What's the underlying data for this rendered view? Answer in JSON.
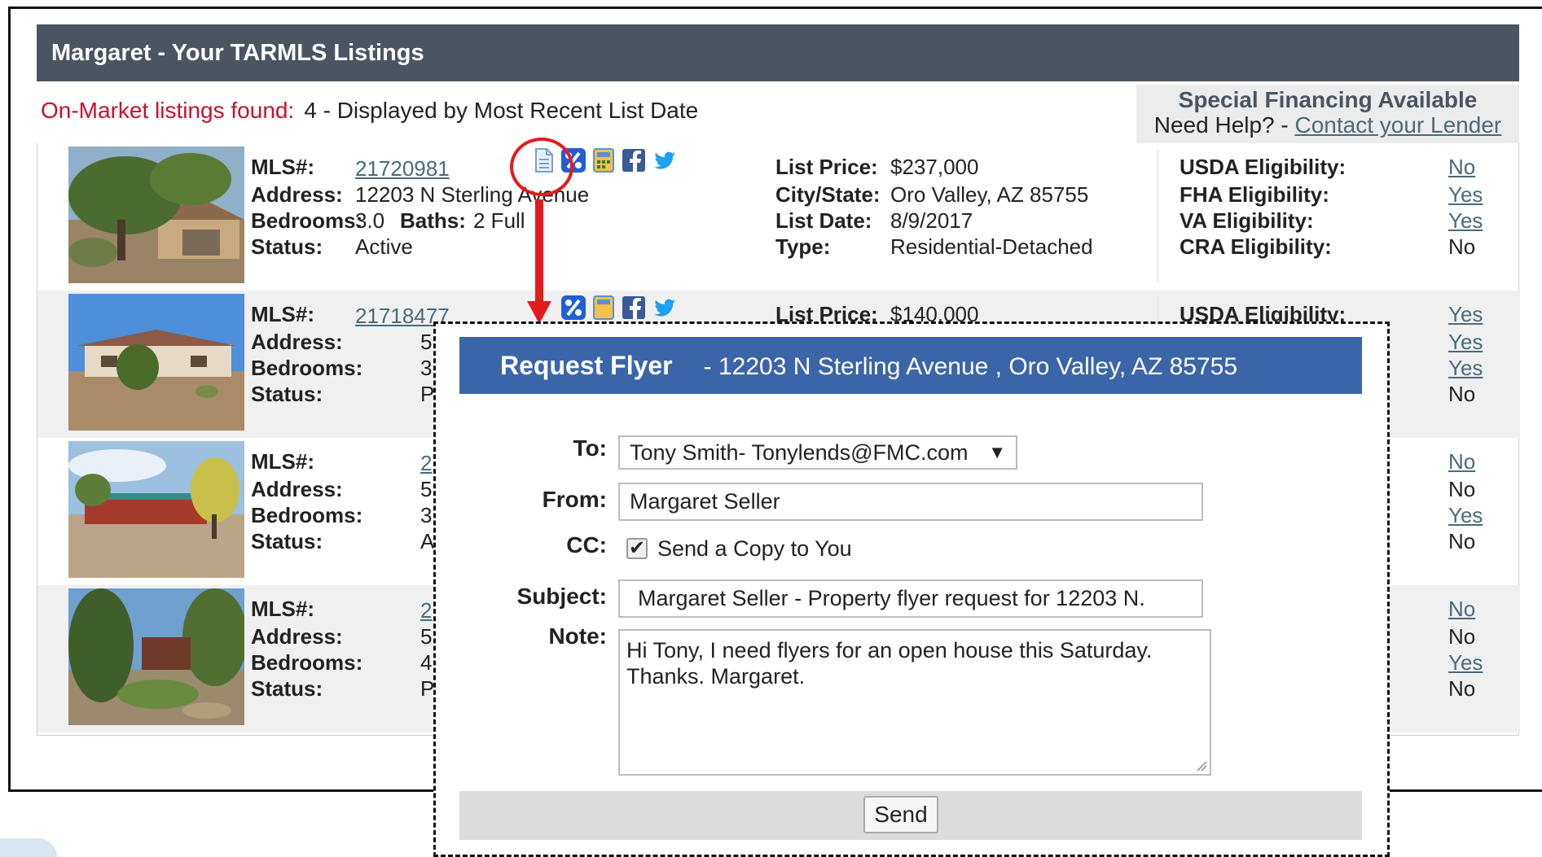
{
  "header": {
    "title": "Margaret  -  Your TARMLS Listings"
  },
  "summary": {
    "label": "On-Market listings found:",
    "value": "4 - Displayed by Most Recent List Date"
  },
  "financing": {
    "title": "Special Financing Available",
    "help_prefix": "Need Help? - ",
    "help_link": "Contact your Lender"
  },
  "labels": {
    "mls": "MLS#:",
    "address": "Address:",
    "bedrooms": "Bedrooms:",
    "baths": "Baths:",
    "status": "Status:",
    "list_price": "List Price:",
    "city_state": "City/State:",
    "list_date": "List Date:",
    "type": "Type:",
    "usda": "USDA Eligibility:",
    "fha": "FHA Eligibility:",
    "va": "VA Eligibility:",
    "cra": "CRA Eligibility:"
  },
  "listings": [
    {
      "mls": "21720981",
      "address": "12203 N Sterling Avenue",
      "bedrooms": "3.0",
      "baths": "2 Full",
      "status": "Active",
      "list_price": "$237,000",
      "city_state": "Oro Valley, AZ 85755",
      "list_date": "8/9/2017",
      "type": "Residential-Detached",
      "usda": "No",
      "fha": "Yes",
      "va": "Yes",
      "cra": "No"
    },
    {
      "mls": "21718477",
      "address": "5",
      "bedrooms": "3",
      "status": "P",
      "list_price": "$140,000",
      "usda": "Yes",
      "fha": "Yes",
      "va": "Yes",
      "cra": "No"
    },
    {
      "mls": "2",
      "address": "5",
      "bedrooms": "3",
      "status": "A",
      "usda": "No",
      "fha": "No",
      "va": "Yes",
      "cra": "No"
    },
    {
      "mls": "2",
      "address": "5",
      "bedrooms": "4",
      "status": "P",
      "usda": "No",
      "fha": "No",
      "va": "Yes",
      "cra": "No"
    }
  ],
  "icons": [
    "flyer-icon",
    "percent-icon",
    "calculator-icon",
    "facebook-icon",
    "twitter-icon"
  ],
  "modal": {
    "title": "Request Flyer",
    "subtitle": "- 12203 N Sterling Avenue , Oro Valley, AZ 85755",
    "to_label": "To:",
    "to_value": "Tony Smith- Tonylends@FMC.com",
    "from_label": "From:",
    "from_value": "Margaret Seller",
    "cc_label": "CC:",
    "cc_text": "Send a Copy to You",
    "cc_checked": true,
    "subject_label": "Subject:",
    "subject_value": "Margaret Seller - Property flyer request for 12203 N.",
    "note_label": "Note:",
    "note_value": "Hi Tony, I need flyers for an open house this Saturday. Thanks. Margaret.",
    "send_label": "Send"
  },
  "colors": {
    "header_bg": "#4a5561",
    "modal_header_bg": "#3a66a8",
    "alert_red": "#c8102e",
    "highlight_red": "#e41b1b",
    "link": "#4a6a7a"
  }
}
